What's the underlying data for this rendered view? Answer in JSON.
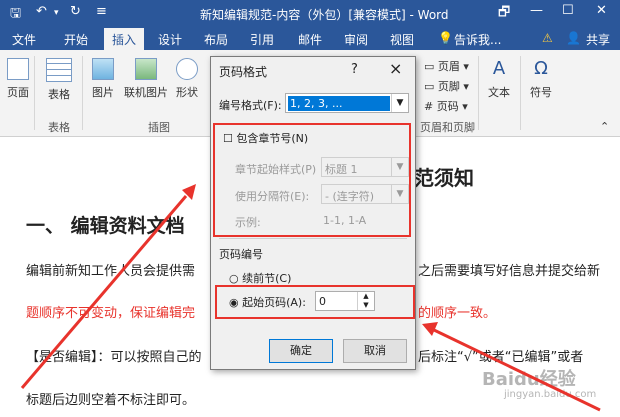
{
  "window": {
    "title": "新知编辑规范-内容（外包）[兼容模式] - Word",
    "restore_btn": "🗗",
    "minimize_btn": "—",
    "maximize_btn": "☐",
    "close_btn": "✕"
  },
  "quick_access": {
    "save": "🖫",
    "undo": "↶",
    "redo": "↻",
    "customize": "≡"
  },
  "tabs": [
    "文件",
    "开始",
    "插入",
    "设计",
    "布局",
    "引用",
    "邮件",
    "审阅",
    "视图"
  ],
  "tell_me": "告诉我...",
  "warning_icon": "⚠",
  "share": "共享",
  "ribbon": {
    "page_btn": "页面",
    "table_btn": "表格",
    "table_group": "表格",
    "picture_btn": "图片",
    "online_picture_btn": "联机图片",
    "shapes_btn": "形状",
    "illustrations_group": "插图",
    "header_btn": "页眉",
    "footer_btn": "页脚",
    "page_number_btn": "页码",
    "header_footer_group": "页眉和页脚",
    "text_btn": "文本",
    "symbol_btn": "符号"
  },
  "document": {
    "heading_tail": "范须知",
    "section_title": "一、  编辑资料文档",
    "line1_left": "编辑前新知工作人员会提供需",
    "line1_right": "之后需要填写好信息并提交给新",
    "line2_left": "题顺序不可变动，保证编辑完",
    "line2_right": "的顺序一致。",
    "line3_left": "【是否编辑】：可以按照自己的",
    "line3_right": "后标注“√”或者“已编辑”或者",
    "line4": "标题后边则空着不标注即可。",
    "watermark": "Baidu经验",
    "watermark_sub": "jingyan.baidu.com"
  },
  "dialog": {
    "title": "页码格式",
    "help": "?",
    "close": "×",
    "number_format_label": "编号格式(F):",
    "number_format_value": "1, 2, 3, ...",
    "include_chapter_label": "包含章节号(N)",
    "chapter_style_label": "章节起始样式(P)",
    "chapter_style_value": "标题 1",
    "separator_label": "使用分隔符(E):",
    "separator_value": "-  (连字符)",
    "example_label": "示例:",
    "example_value": "1-1, 1-A",
    "page_numbering_label": "页码编号",
    "continue_label": "续前节(C)",
    "start_at_label": "起始页码(A):",
    "start_at_value": "0",
    "ok": "确定",
    "cancel": "取消"
  },
  "colors": {
    "accent": "#2b579a",
    "annotation": "#e8332c"
  }
}
